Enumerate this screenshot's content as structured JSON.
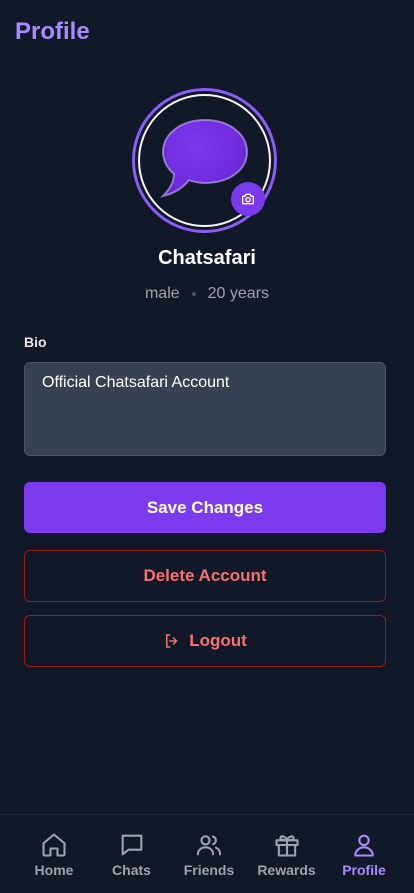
{
  "header": {
    "title": "Profile"
  },
  "profile": {
    "username": "Chatsafari",
    "gender": "male",
    "age": "20 years",
    "avatar_icon": "chat-bubble-icon",
    "camera_icon": "camera-icon"
  },
  "bio": {
    "label": "Bio",
    "value": "Official Chatsafari Account"
  },
  "actions": {
    "save_label": "Save Changes",
    "delete_label": "Delete Account",
    "logout_label": "Logout"
  },
  "nav": {
    "items": [
      {
        "label": "Home",
        "icon": "home-icon"
      },
      {
        "label": "Chats",
        "icon": "chat-icon"
      },
      {
        "label": "Friends",
        "icon": "friends-icon"
      },
      {
        "label": "Rewards",
        "icon": "gift-icon"
      },
      {
        "label": "Profile",
        "icon": "user-icon"
      }
    ],
    "active": "Profile"
  },
  "colors": {
    "accent": "#7c3aed",
    "accent_light": "#a78bfa",
    "danger": "#f87171",
    "background": "#111827"
  }
}
